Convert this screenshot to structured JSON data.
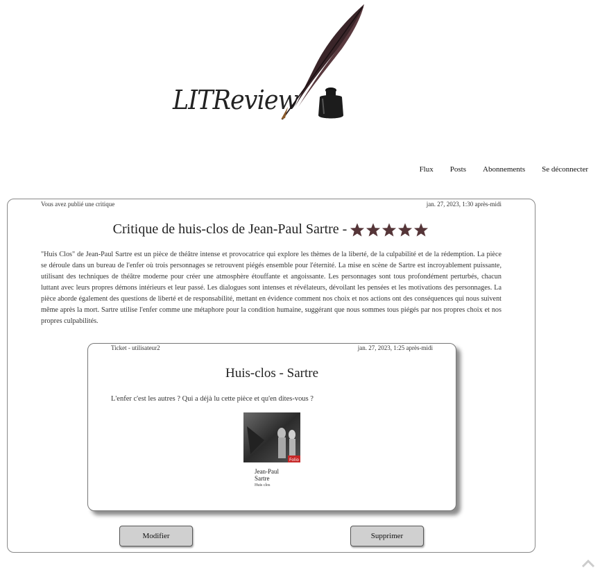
{
  "logo": {
    "text": "LITReview"
  },
  "nav": {
    "items": [
      {
        "label": "Flux"
      },
      {
        "label": "Posts"
      },
      {
        "label": "Abonnements"
      },
      {
        "label": "Se déconnecter"
      }
    ]
  },
  "review": {
    "header_left": "Vous avez publié une critique",
    "header_right": "jan. 27, 2023, 1:30 après-midi",
    "title": "Critique de huis-clos de Jean-Paul Sartre -",
    "rating": 5,
    "rating_max": 5,
    "star_color": "#553538",
    "body": "\"Huis Clos\" de Jean-Paul Sartre est un pièce de théâtre intense et provocatrice qui explore les thèmes de la liberté, de la culpabilité et de la rédemption. La pièce se déroule dans un bureau de l'enfer où trois personnages se retrouvent piégés ensemble pour l'éternité. La mise en scène de Sartre est incroyablement puissante, utilisant des techniques de théâtre moderne pour créer une atmosphère étouffante et angoissante. Les personnages sont tous profondément perturbés, chacun luttant avec leurs propres démons intérieurs et leur passé. Les dialogues sont intenses et révélateurs, dévoilant les pensées et les motivations des personnages. La pièce aborde également des questions de liberté et de responsabilité, mettant en évidence comment nos choix et nos actions ont des conséquences qui nous suivent même après la mort. Sartre utilise l'enfer comme une métaphore pour la condition humaine, suggérant que nous sommes tous piégés par nos propres choix et nos propres culpabilités."
  },
  "ticket": {
    "header_left": "Ticket - utilisateur2",
    "header_right": "jan. 27, 2023, 1:25 après-midi",
    "title": "Huis-clos - Sartre",
    "description": "L'enfer c'est les autres ? Qui a déjà lu cette pièce et qu'en dites-vous ?",
    "cover": {
      "author_first": "Jean-Paul",
      "author_last": "Sartre",
      "subtitle": "Huis clos",
      "publisher": "Folio"
    }
  },
  "actions": {
    "edit_label": "Modifier",
    "delete_label": "Supprimer"
  }
}
